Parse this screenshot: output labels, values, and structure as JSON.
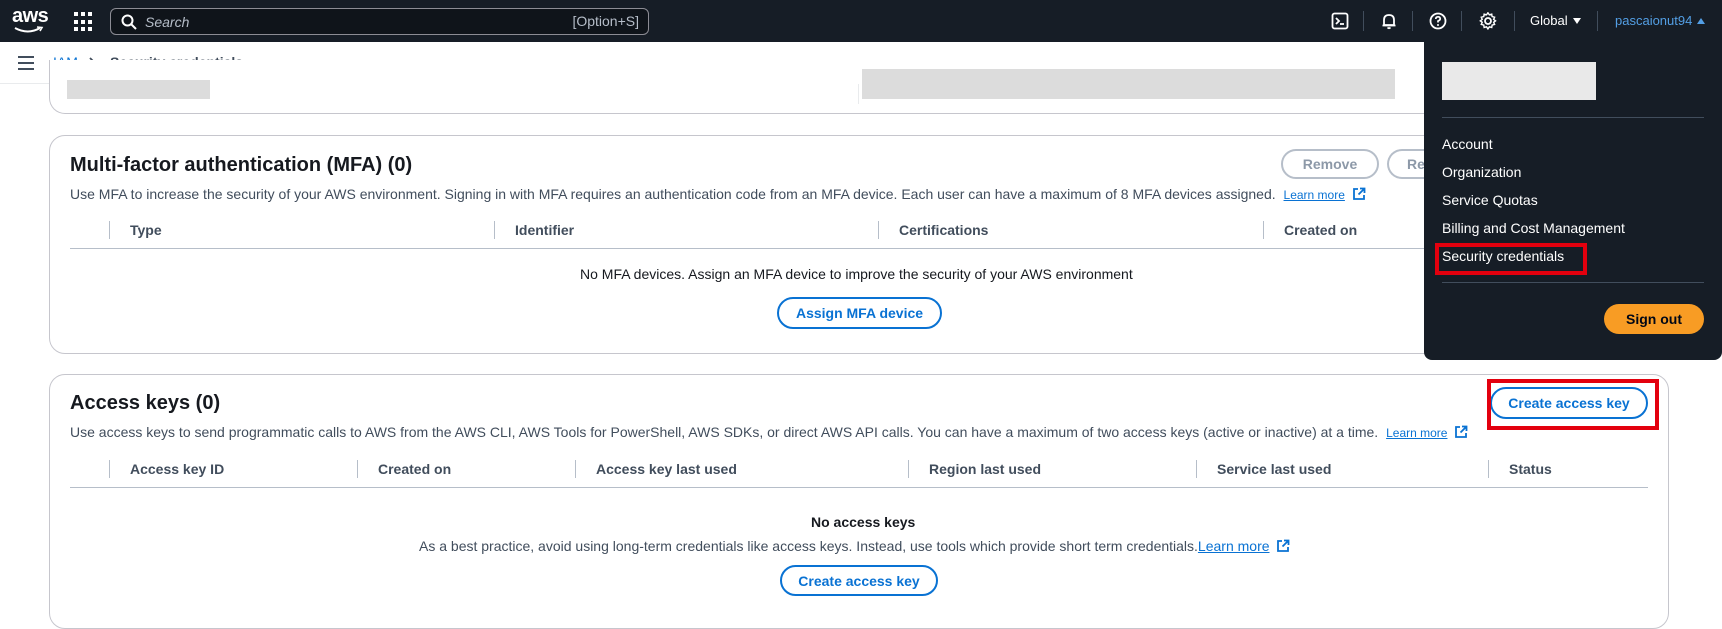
{
  "topnav": {
    "logo_text": "aws",
    "search_placeholder": "Search",
    "search_shortcut": "[Option+S]",
    "region": "Global",
    "user": "pascaionut94",
    "icons": [
      "apps-grid-icon",
      "cloudshell-icon",
      "bell-icon",
      "help-icon",
      "gear-icon"
    ]
  },
  "breadcrumb": {
    "root": "IAM",
    "current": "Security credentials"
  },
  "mfa": {
    "title": "Multi-factor authentication (MFA) (0)",
    "description": "Use MFA to increase the security of your AWS environment. Signing in with MFA requires an authentication code from an MFA device. Each user can have a maximum of 8 MFA devices assigned.",
    "learn_more": "Learn more",
    "remove_label": "Remove",
    "resync_label": "Re",
    "columns": [
      "Type",
      "Identifier",
      "Certifications",
      "Created on"
    ],
    "empty_message": "No MFA devices. Assign an MFA device to improve the security of your AWS environment",
    "assign_label": "Assign MFA device"
  },
  "access_keys": {
    "title": "Access keys (0)",
    "description": "Use access keys to send programmatic calls to AWS from the AWS CLI, AWS Tools for PowerShell, AWS SDKs, or direct AWS API calls. You can have a maximum of two access keys (active or inactive) at a time.",
    "learn_more": "Learn more",
    "create_label": "Create access key",
    "columns": [
      "Access key ID",
      "Created on",
      "Access key last used",
      "Region last used",
      "Service last used",
      "Status"
    ],
    "empty_title": "No access keys",
    "empty_message": "As a best practice, avoid using long-term credentials like access keys. Instead, use tools which provide short term credentials.",
    "empty_learn_more": "Learn more",
    "empty_create_label": "Create access key"
  },
  "account_menu": {
    "items": [
      "Account",
      "Organization",
      "Service Quotas",
      "Billing and Cost Management",
      "Security credentials"
    ],
    "sign_out": "Sign out"
  },
  "colors": {
    "nav_bg": "#161d26",
    "link": "#0972d3",
    "sign_out": "#f89c24",
    "annotation": "#e3000e"
  }
}
